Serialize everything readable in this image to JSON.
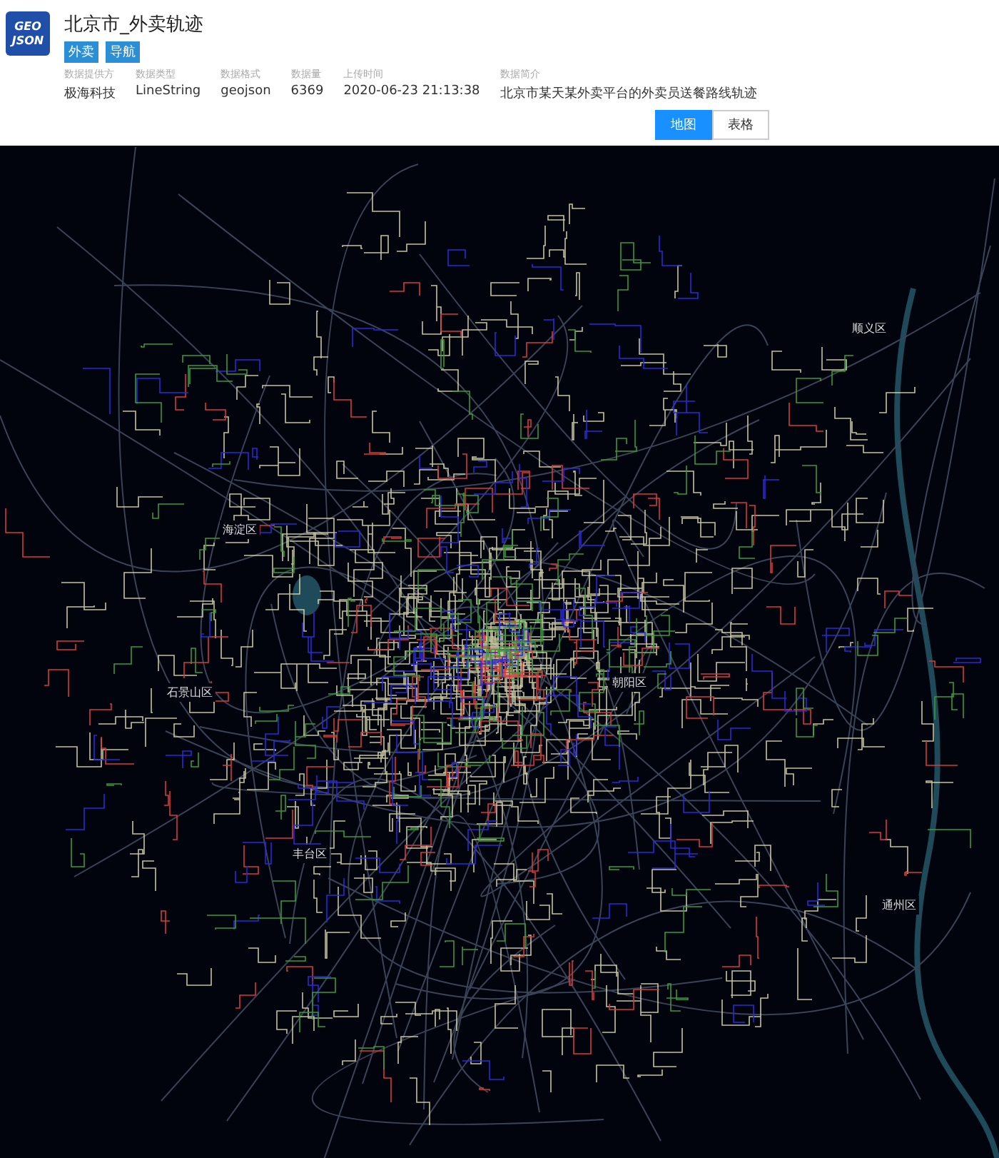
{
  "logo": {
    "line_1": "GEO",
    "line_2": "JSON"
  },
  "title": "北京市_外卖轨迹",
  "tags": [
    "外卖",
    "导航"
  ],
  "meta": [
    {
      "label": "数据提供方",
      "value": "极海科技"
    },
    {
      "label": "数据类型",
      "value": "LineString"
    },
    {
      "label": "数据格式",
      "value": "geojson"
    },
    {
      "label": "数据量",
      "value": "6369"
    },
    {
      "label": "上传时间",
      "value": "2020-06-23 21:13:38"
    },
    {
      "label": "数据简介",
      "value": "北京市某天某外卖平台的外卖员送餐路线轨迹"
    }
  ],
  "view_toggle": [
    {
      "label": "地图",
      "selected": true
    },
    {
      "label": "表格",
      "selected": false
    }
  ],
  "map_labels": [
    "顺义区",
    "海淀区",
    "朝阳区",
    "石景山区",
    "丰台区",
    "通州区"
  ]
}
